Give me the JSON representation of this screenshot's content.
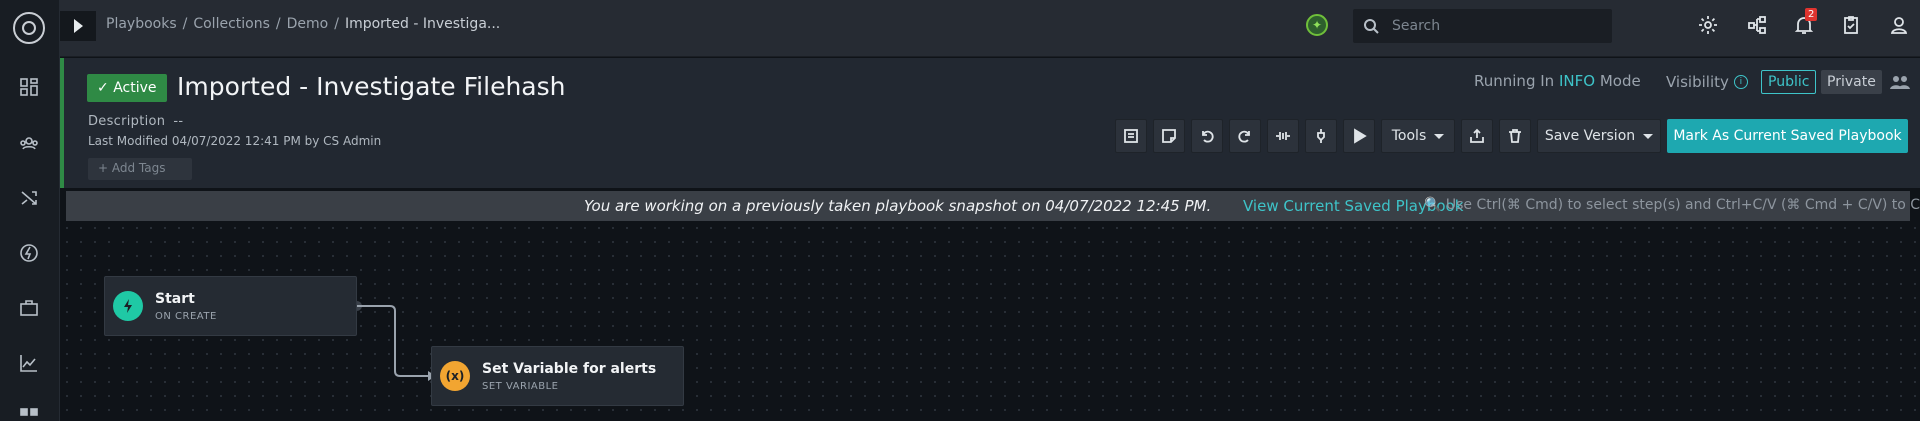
{
  "breadcrumb": {
    "items": [
      "Playbooks",
      "Collections",
      "Demo"
    ],
    "separator": "/",
    "current": "Imported - Investiga..."
  },
  "search": {
    "placeholder": "Search"
  },
  "notifications": {
    "count": "2"
  },
  "playbook": {
    "status": "Active",
    "title": "Imported - Investigate Filehash",
    "description_label": "Description",
    "description_value": "--",
    "last_modified": "Last Modified 04/07/2022 12:41 PM by CS Admin",
    "add_tags": "+ Add Tags"
  },
  "mode": {
    "prefix": "Running In",
    "value": "INFO",
    "suffix": "Mode"
  },
  "visibility": {
    "label": "Visibility",
    "public": "Public",
    "private": "Private"
  },
  "toolbar": {
    "tools_label": "Tools",
    "save_version_label": "Save Version",
    "mark_current_label": "Mark As Current Saved Playbook"
  },
  "banner": {
    "message": "You are working on a previously taken playbook snapshot on 04/07/2022 12:45 PM.",
    "link": "View Current Saved Playbook",
    "hint": "Use Ctrl(⌘ Cmd) to select step(s) and Ctrl+C/V (⌘ Cmd + C/V) to Copy/Paste."
  },
  "nodes": [
    {
      "name": "Start",
      "type": "ON CREATE",
      "icon": "bolt-icon",
      "color": "#1fc9a5"
    },
    {
      "name": "Set Variable for alerts",
      "type": "SET VARIABLE",
      "icon": "variable-icon",
      "icon_text": "(x)",
      "color": "#f2a531"
    }
  ],
  "colors": {
    "accent": "#1ea8b0",
    "active": "#2f8a45",
    "badge": "#e0342f"
  }
}
